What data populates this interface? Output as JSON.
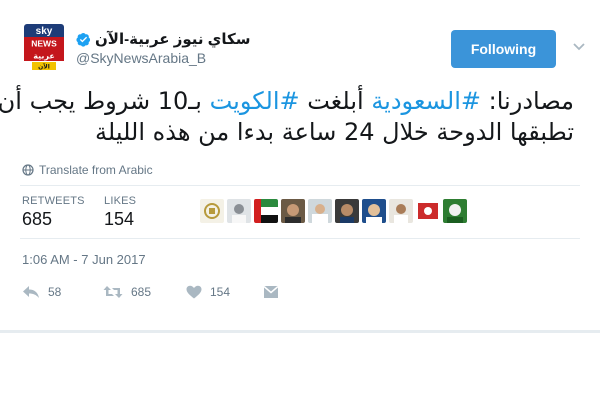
{
  "account": {
    "display_name": "سكاي نيوز عربية-الآن",
    "handle": "@SkyNewsArabia_B",
    "logo_text_top": "sky",
    "logo_text_mid": "NEWS",
    "logo_text_bottom": "عربية",
    "logo_text_sub": "الآن"
  },
  "follow_button": {
    "label": "Following"
  },
  "tweet": {
    "line1_prefix": "مصادرنا: ",
    "hashtag1": "#السعودية",
    "line1_mid": " أبلغت ",
    "hashtag2": "#الكويت",
    "line1_suffix": " بـ10 شروط يجب أن",
    "line2": "تطبقها الدوحة خلال 24 ساعة بدءا من هذه الليلة"
  },
  "translate": {
    "label": "Translate from Arabic",
    "icon": "globe-icon"
  },
  "stats": {
    "retweets_label": "RETWEETS",
    "retweets_value": "685",
    "likes_label": "LIKES",
    "likes_value": "154"
  },
  "timestamp": "1:06 AM - 7 Jun 2017",
  "actions": {
    "reply_count": "58",
    "retweet_count": "685",
    "like_count": "154"
  },
  "colors": {
    "follow_bg": "#3b94d9",
    "hashtag": "#1b95e0",
    "muted": "#657786",
    "logo_red": "#c4161c"
  }
}
